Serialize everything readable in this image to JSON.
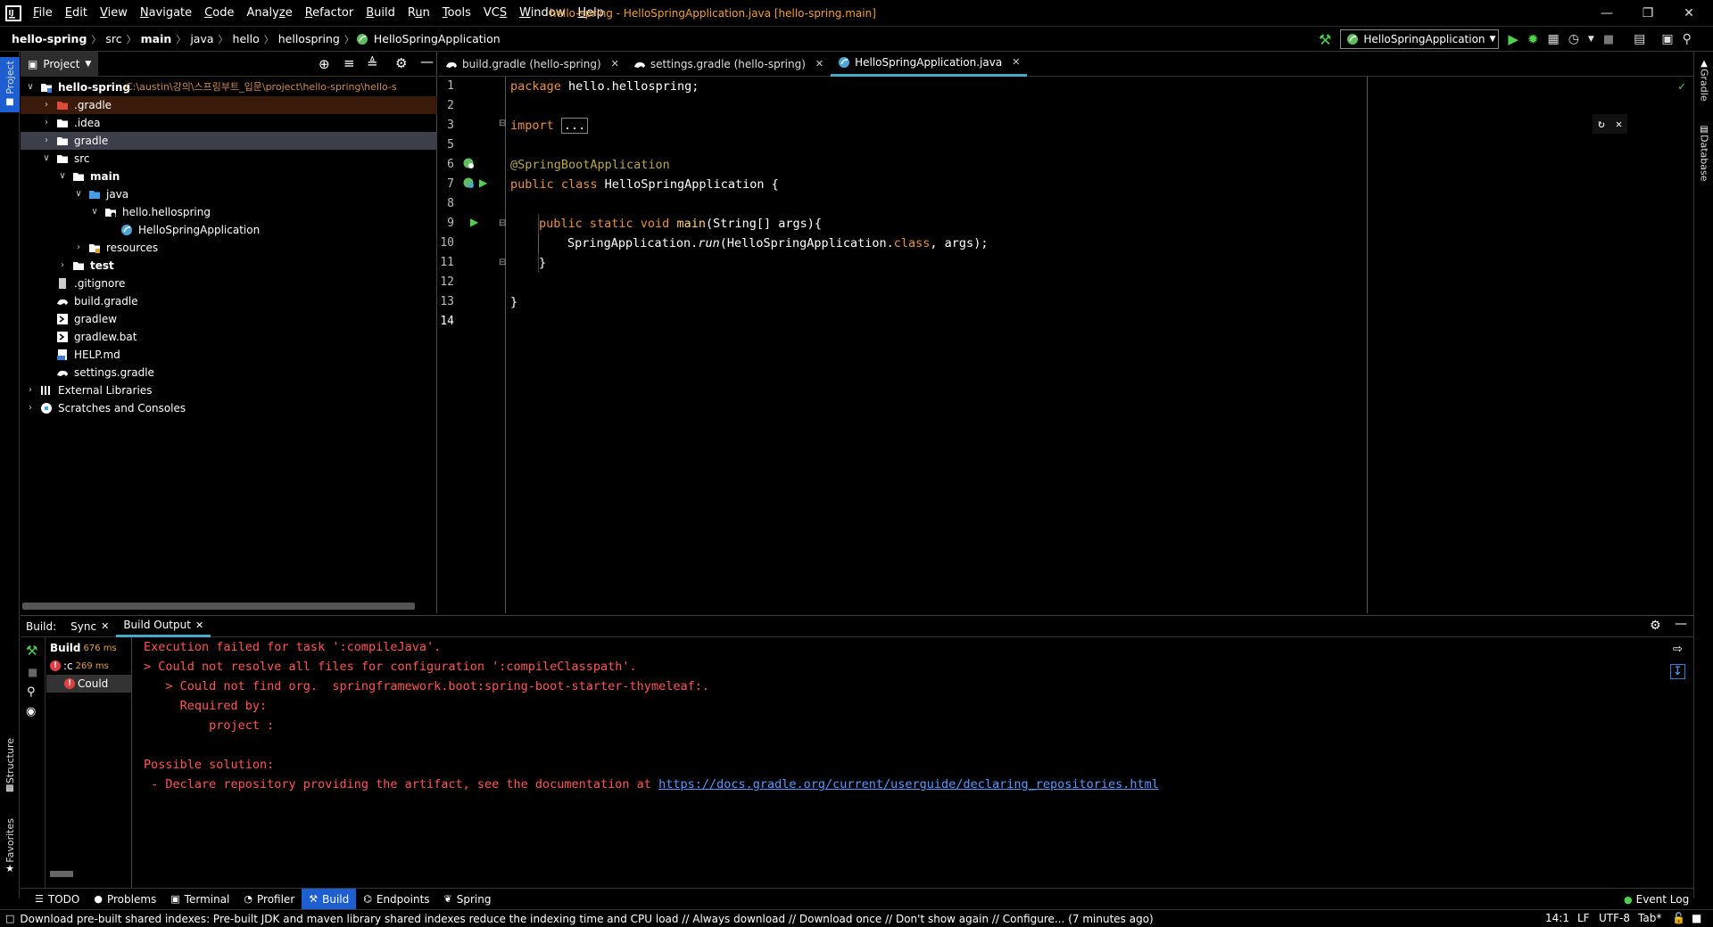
{
  "titlebar": {
    "menus": [
      "File",
      "Edit",
      "View",
      "Navigate",
      "Code",
      "Analyze",
      "Refactor",
      "Build",
      "Run",
      "Tools",
      "VCS",
      "Window",
      "Help"
    ],
    "mnemonics": [
      "F",
      "E",
      "V",
      "N",
      "C",
      "z",
      "R",
      "B",
      "u",
      "T",
      "S",
      "W",
      "H"
    ],
    "window_title": "hello-spring - HelloSpringApplication.java [hello-spring.main]",
    "accent": "#f0a030"
  },
  "breadcrumb": {
    "items": [
      "hello-spring",
      "src",
      "main",
      "java",
      "hello",
      "hellospring",
      "HelloSpringApplication"
    ]
  },
  "run_config": {
    "label": "HelloSpringApplication"
  },
  "left_strip": {
    "project": "Project",
    "structure": "Structure",
    "favorites": "Favorites"
  },
  "right_strip": {
    "gradle": "Gradle",
    "database": "Database"
  },
  "project_panel": {
    "title": "Project",
    "root_name": "hello-spring",
    "root_path": "C:\\austin\\강의\\스프링부트_입문\\project\\hello-spring\\hello-s",
    "items": [
      {
        "label": ".gradle",
        "depth": 1,
        "arrow": "right",
        "icon": "folder-red",
        "highlight": "#3a1a0a"
      },
      {
        "label": ".idea",
        "depth": 1,
        "arrow": "right",
        "icon": "folder",
        "highlight": ""
      },
      {
        "label": "gradle",
        "depth": 1,
        "arrow": "right",
        "icon": "folder",
        "highlight": "#3c3f4a"
      },
      {
        "label": "src",
        "depth": 1,
        "arrow": "down",
        "icon": "folder",
        "highlight": ""
      },
      {
        "label": "main",
        "depth": 2,
        "arrow": "down",
        "icon": "folder",
        "highlight": "",
        "bold": true
      },
      {
        "label": "java",
        "depth": 3,
        "arrow": "down",
        "icon": "folder-blue",
        "highlight": ""
      },
      {
        "label": "hello.hellospring",
        "depth": 4,
        "arrow": "down",
        "icon": "package",
        "highlight": ""
      },
      {
        "label": "HelloSpringApplication",
        "depth": 5,
        "arrow": "",
        "icon": "spring",
        "highlight": ""
      },
      {
        "label": "resources",
        "depth": 3,
        "arrow": "right",
        "icon": "folder-res",
        "highlight": ""
      },
      {
        "label": "test",
        "depth": 2,
        "arrow": "right",
        "icon": "folder",
        "highlight": "",
        "bold": true
      },
      {
        "label": ".gitignore",
        "depth": 1,
        "arrow": "",
        "icon": "file",
        "highlight": ""
      },
      {
        "label": "build.gradle",
        "depth": 1,
        "arrow": "",
        "icon": "gradle",
        "highlight": ""
      },
      {
        "label": "gradlew",
        "depth": 1,
        "arrow": "",
        "icon": "exec",
        "highlight": ""
      },
      {
        "label": "gradlew.bat",
        "depth": 1,
        "arrow": "",
        "icon": "exec",
        "highlight": ""
      },
      {
        "label": "HELP.md",
        "depth": 1,
        "arrow": "",
        "icon": "md",
        "highlight": ""
      },
      {
        "label": "settings.gradle",
        "depth": 1,
        "arrow": "",
        "icon": "gradle",
        "highlight": ""
      },
      {
        "label": "External Libraries",
        "depth": 0,
        "arrow": "right",
        "icon": "libs",
        "highlight": ""
      },
      {
        "label": "Scratches and Consoles",
        "depth": 0,
        "arrow": "right",
        "icon": "scratch",
        "highlight": ""
      }
    ]
  },
  "editor": {
    "tabs": [
      {
        "label": "build.gradle (hello-spring)",
        "icon": "gradle",
        "active": false
      },
      {
        "label": "settings.gradle (hello-spring)",
        "icon": "gradle",
        "active": false
      },
      {
        "label": "HelloSpringApplication.java",
        "icon": "spring",
        "active": true
      }
    ],
    "line_numbers": [
      "1",
      "2",
      "3",
      "5",
      "6",
      "7",
      "8",
      "9",
      "10",
      "11",
      "12",
      "13",
      "14"
    ],
    "code": {
      "l1_kw": "package",
      "l1_rest": " hello.hellospring;",
      "l3_kw": "import",
      "l3_fold": "...",
      "l6_ann": "@SpringBootApplication",
      "l7_kw": "public class",
      "l7_rest": " HelloSpringApplication {",
      "l9_kw": "public static void",
      "l9_fn": "main",
      "l9_rest": "(String[] args){",
      "l10_a": "SpringApplication.",
      "l10_fn": "run",
      "l10_b": "(HelloSpringApplication.",
      "l10_kw": "class",
      "l10_c": ", args);",
      "l11": "}",
      "l13": "}"
    },
    "current_line": "14"
  },
  "build": {
    "label": "Build:",
    "tabs": [
      {
        "label": "Sync",
        "active": false
      },
      {
        "label": "Build Output",
        "active": true
      }
    ],
    "tree": [
      {
        "label": "Build",
        "time": "676 ms"
      },
      {
        "label": ":c",
        "time": "269 ms"
      },
      {
        "label": "Could",
        "time": ""
      }
    ],
    "output": {
      "line1": "Execution failed for task ':compileJava'.",
      "line2": "> Could not resolve all files for configuration ':compileClasspath'.",
      "line3": "   > Could not find org.  springframework.boot:spring-boot-starter-thymeleaf:.",
      "line4": "     Required by:",
      "line5": "         project :",
      "line6": "Possible solution:",
      "line7_prefix": " - Declare repository providing the artifact, see the documentation at ",
      "line7_link": "https://docs.gradle.org/current/userguide/declaring_repositories.html"
    }
  },
  "tool_windows": [
    {
      "label": "TODO",
      "icon": "todo-icon",
      "active": false
    },
    {
      "label": "Problems",
      "icon": "problems-icon",
      "active": false
    },
    {
      "label": "Terminal",
      "icon": "terminal-icon",
      "active": false
    },
    {
      "label": "Profiler",
      "icon": "profiler-icon",
      "active": false
    },
    {
      "label": "Build",
      "icon": "hammer-icon",
      "active": true
    },
    {
      "label": "Endpoints",
      "icon": "endpoints-icon",
      "active": false
    },
    {
      "label": "Spring",
      "icon": "spring-icon",
      "active": false
    }
  ],
  "event_log": "Event Log",
  "status": {
    "message": "Download pre-built shared indexes: Pre-built JDK and maven library shared indexes reduce the indexing time and CPU load // Always download // Download once // Don't show again // Configure... (7 minutes ago)",
    "position": "14:1",
    "line_sep": "LF",
    "encoding": "UTF-8",
    "indent": "Tab*"
  }
}
